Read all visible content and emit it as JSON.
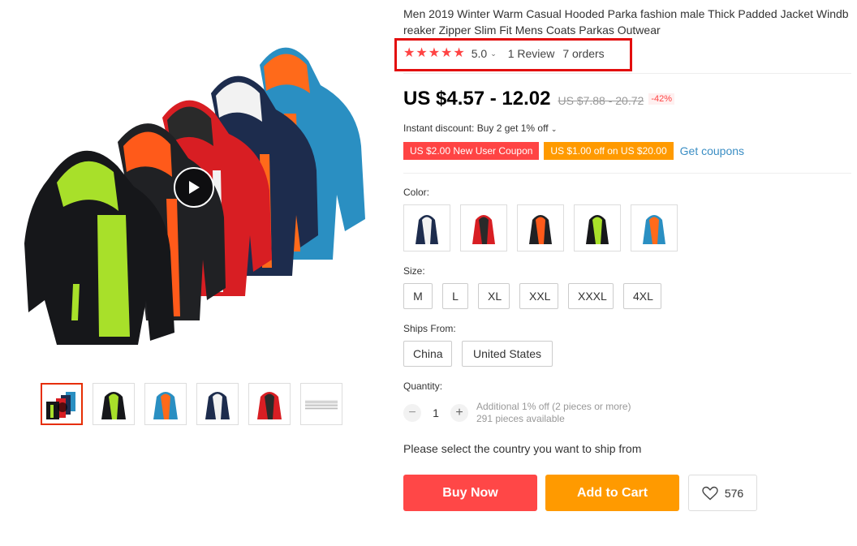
{
  "product": {
    "title": "Men 2019 Winter Warm Casual Hooded Parka fashion male Thick Padded Jacket Windbreaker Zipper Slim Fit Mens Coats Parkas Outwear",
    "rating": {
      "stars": 5,
      "value": "5.0",
      "reviews": "1 Review",
      "orders": "7 orders"
    },
    "price": {
      "current": "US $4.57 - 12.02",
      "original": "US $7.88 - 20.72",
      "discount": "-42%"
    },
    "instant_discount": "Instant discount: Buy 2 get 1% off",
    "coupons": [
      "US $2.00 New User Coupon",
      "US $1.00 off on US $20.00"
    ],
    "get_coupons": "Get coupons",
    "color_label": "Color:",
    "size_label": "Size:",
    "sizes": [
      "M",
      "L",
      "XL",
      "XXL",
      "XXXL",
      "4XL"
    ],
    "ships_from_label": "Ships From:",
    "ships_from": [
      "China",
      "United States"
    ],
    "quantity_label": "Quantity:",
    "quantity": "1",
    "quantity_note": "Additional 1% off (2 pieces or more)",
    "available": "291 pieces available",
    "ship_note": "Please select the country you want to ship from",
    "buy_now": "Buy Now",
    "add_to_cart": "Add to Cart",
    "wishlist_count": "576"
  },
  "colors": {
    "accent": "#ff4747",
    "orange": "#ff9a00",
    "highlight_box": "#e30e0e",
    "star": "#ff4747",
    "link": "#3b8ec4"
  }
}
